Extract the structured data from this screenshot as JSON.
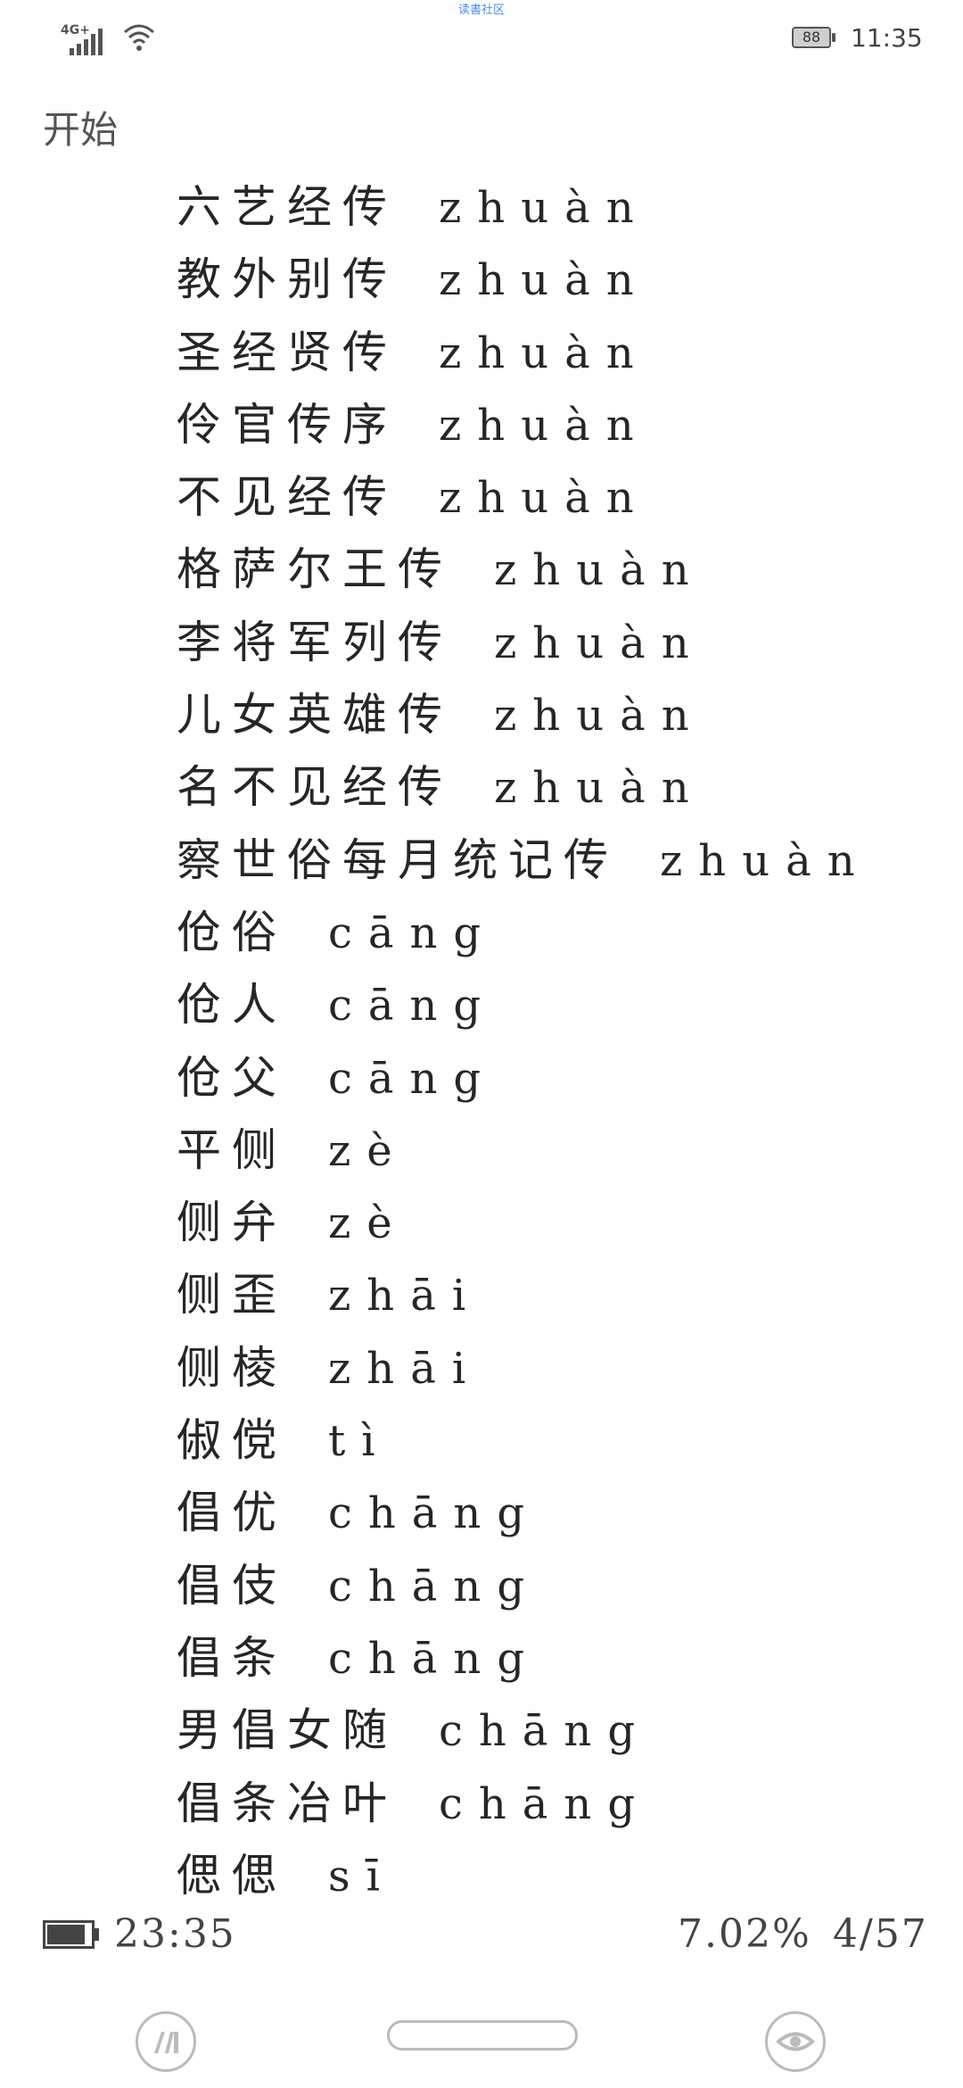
{
  "status_bar": {
    "top_center_text": "读書社区",
    "network": "4G+",
    "battery_level": "88",
    "time": "11:35"
  },
  "chapter_title": "开始",
  "lines": [
    {
      "word": "六艺经传",
      "pinyin": "zhuàn"
    },
    {
      "word": "教外别传",
      "pinyin": "zhuàn"
    },
    {
      "word": "圣经贤传",
      "pinyin": "zhuàn"
    },
    {
      "word": "伶官传序",
      "pinyin": "zhuàn"
    },
    {
      "word": "不见经传",
      "pinyin": "zhuàn"
    },
    {
      "word": "格萨尔王传",
      "pinyin": "zhuàn"
    },
    {
      "word": "李将军列传",
      "pinyin": "zhuàn"
    },
    {
      "word": "儿女英雄传",
      "pinyin": "zhuàn"
    },
    {
      "word": "名不见经传",
      "pinyin": "zhuàn"
    },
    {
      "word": "察世俗每月统记传",
      "pinyin": "zhuàn"
    },
    {
      "word": "伧俗",
      "pinyin": "cāng"
    },
    {
      "word": "伧人",
      "pinyin": "cāng"
    },
    {
      "word": "伧父",
      "pinyin": "cāng"
    },
    {
      "word": "平侧",
      "pinyin": "zè"
    },
    {
      "word": "侧弁",
      "pinyin": "zè"
    },
    {
      "word": "侧歪",
      "pinyin": "zhāi"
    },
    {
      "word": "侧棱",
      "pinyin": "zhāi"
    },
    {
      "word": "俶傥",
      "pinyin": "tì"
    },
    {
      "word": "倡优",
      "pinyin": "chāng"
    },
    {
      "word": "倡伎",
      "pinyin": "chāng"
    },
    {
      "word": "倡条",
      "pinyin": "chāng"
    },
    {
      "word": "男倡女随",
      "pinyin": "chāng"
    },
    {
      "word": "倡条冶叶",
      "pinyin": "chāng"
    },
    {
      "word": "偲偲",
      "pinyin": "sī"
    }
  ],
  "footer": {
    "battery_fill_fraction": 0.88,
    "time": "23:35",
    "progress": "7.02%",
    "page": "4/57"
  },
  "nav": {
    "left_icon": "reader-app-icon",
    "center": "home-pill",
    "right_icon": "eye-icon"
  }
}
